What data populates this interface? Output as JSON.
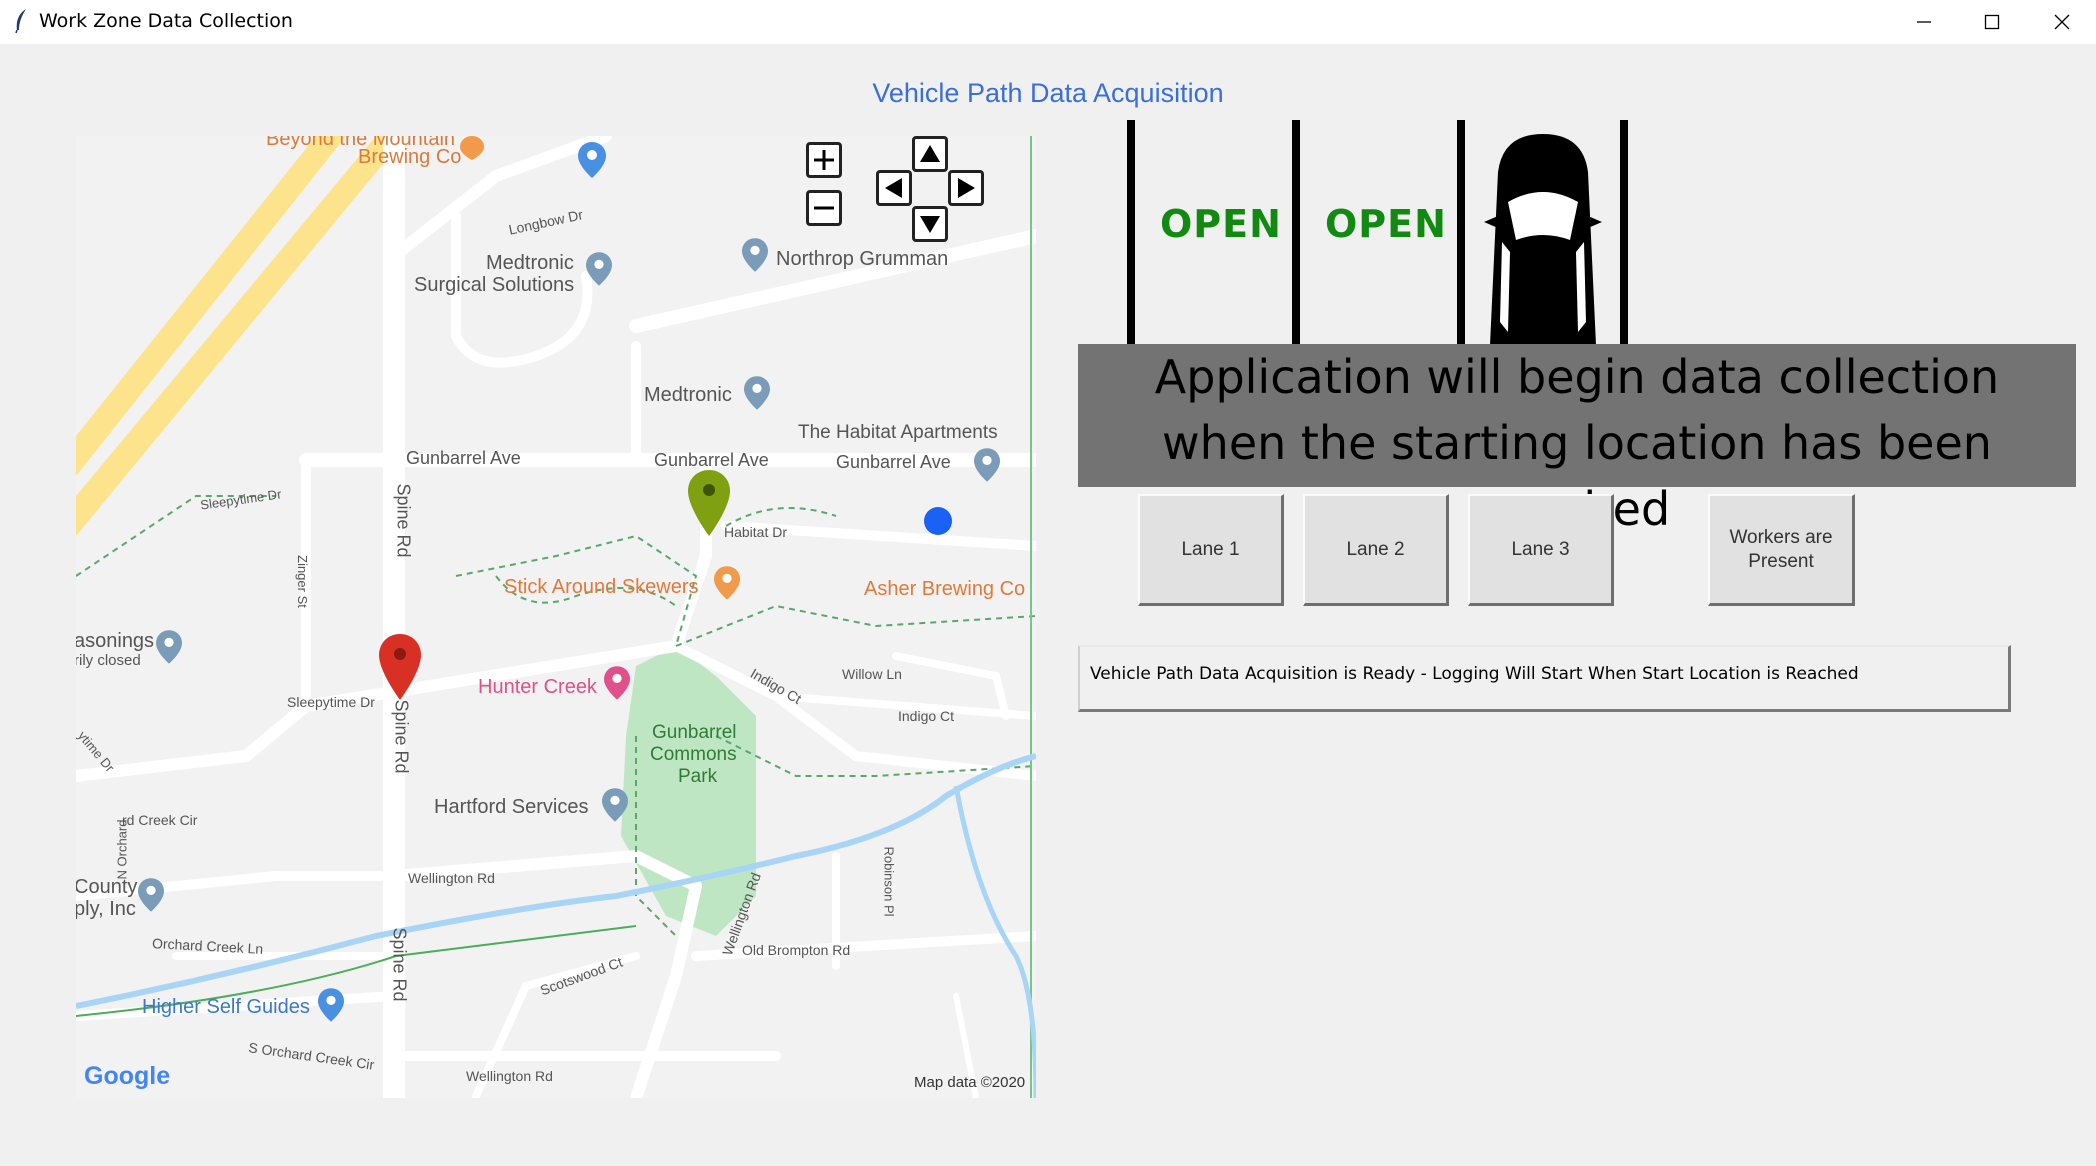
{
  "window": {
    "title": "Work Zone Data Collection",
    "app_icon": "feather-icon"
  },
  "header": {
    "title": "Vehicle Path Data Acquisition",
    "title_color": "#3a6fd8"
  },
  "map": {
    "attribution": "Map data ©2020",
    "logo_text": "Google",
    "labels": {
      "brewing_top_1": "Beyond the Mountain",
      "brewing_top_2": "Brewing Co",
      "longbow": "Longbow Dr",
      "medtronic_surgical_1": "Medtronic",
      "medtronic_surgical_2": "Surgical Solutions",
      "northrop": "Northrop Grumman",
      "medtronic": "Medtronic",
      "habitat_apts": "The Habitat Apartments",
      "gunbarrel_1": "Gunbarrel Ave",
      "gunbarrel_2": "Gunbarrel Ave",
      "gunbarrel_3": "Gunbarrel Ave",
      "sleepytime_1": "Sleepytime Dr",
      "spine_1": "Spine Rd",
      "habitat_dr": "Habitat Dr",
      "zinger": "Zinger St",
      "stick_around": "Stick Around Skewers",
      "asher": "Asher Brewing Co",
      "masonings_1": "asonings",
      "masonings_2": "rily closed",
      "willow": "Willow Ln",
      "indigo_1": "Indigo Ct",
      "indigo_2": "Indigo Ct",
      "hunter_creek": "Hunter Creek",
      "sleepytime_2": "Sleepytime Dr",
      "spine_2": "Spine Rd",
      "park_1": "Gunbarrel",
      "park_2": "Commons",
      "park_3": "Park",
      "sleepytime_3": "ytime Dr",
      "hartford": "Hartford Services",
      "orchard_creek_cir": "rd Creek Cir",
      "n_orchard": "N Orchard",
      "wellington_1": "Wellington Rd",
      "robinson": "Robinson Pl",
      "county_1": "County",
      "county_2": "ply, Inc",
      "orchard_creek_ln": "Orchard Creek Ln",
      "wellington_2": "Wellington Rd",
      "old_brompton": "Old Brompton Rd",
      "spine_3": "Spine Rd",
      "scotswood": "Scotswood Ct",
      "higher_self": "Higher Self Guides",
      "s_orchard": "S Orchard Creek Cir",
      "wellington_3": "Wellington Rd"
    },
    "colors": {
      "start_marker": "#7fa010",
      "end_marker": "#d93025",
      "vehicle_dot": "#1a62f5",
      "park": "#bfe6c3",
      "water": "#a8d4f5",
      "highway": "#fde48c"
    }
  },
  "lanes": {
    "lane1_status": "OPEN",
    "lane2_status": "OPEN",
    "lane3_status": "vehicle-icon",
    "open_color": "#128a12"
  },
  "banner": {
    "line1": "Application will begin data collection",
    "line2": "when the starting location has been reached"
  },
  "buttons": {
    "lane1": "Lane 1",
    "lane2": "Lane 2",
    "lane3": "Lane 3",
    "workers_line1": "Workers are",
    "workers_line2": "Present"
  },
  "status": {
    "message": "Vehicle Path Data Acquisition is Ready - Logging Will Start When Start Location is Reached"
  }
}
